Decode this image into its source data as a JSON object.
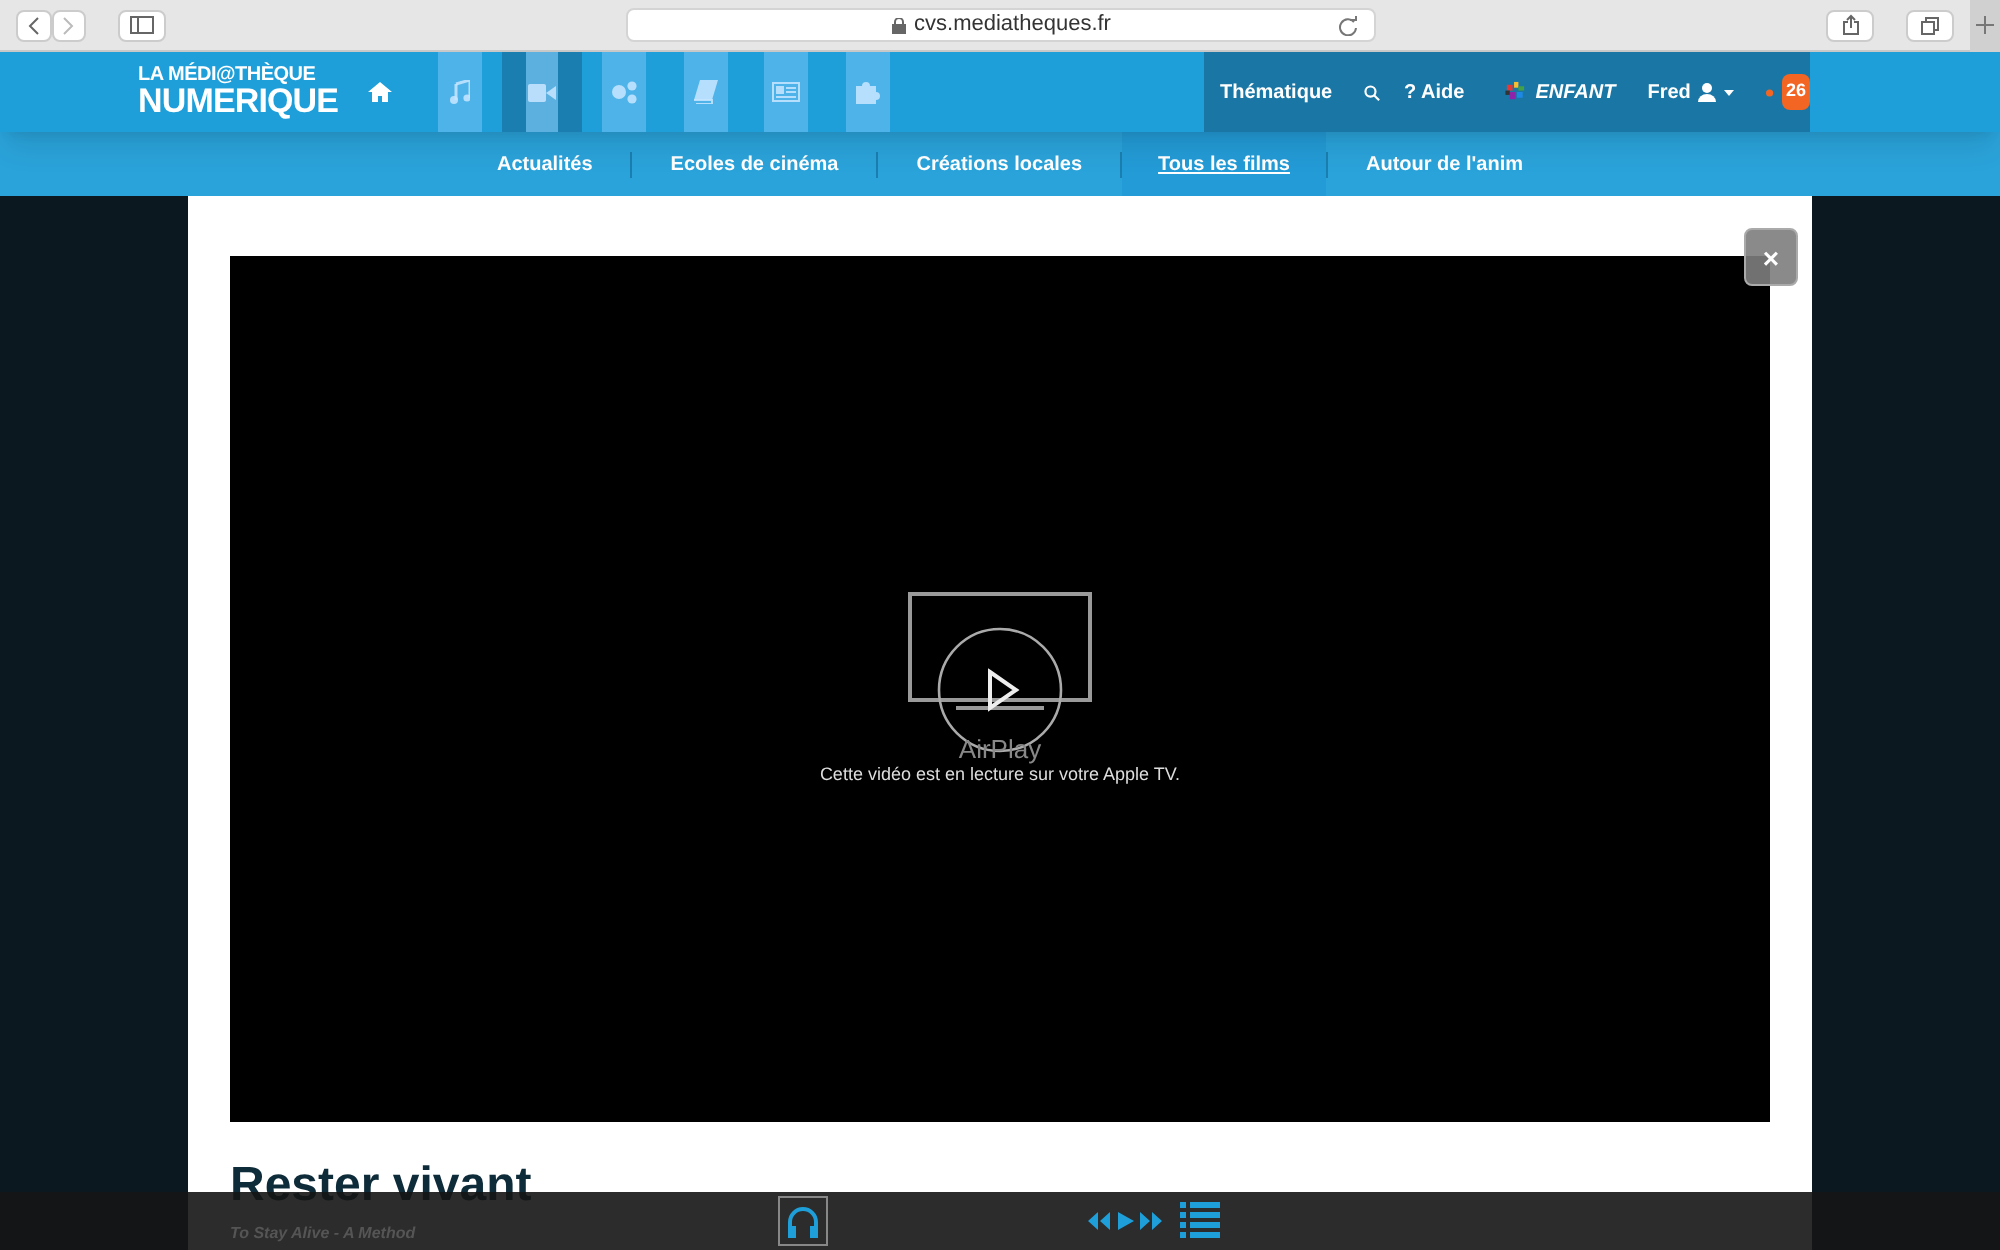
{
  "browser": {
    "url": "cvs.mediatheques.fr"
  },
  "header": {
    "logo": [
      "LA MÉDI@THÈQUE",
      "NUMERIQUE"
    ],
    "nav": [
      {
        "kind": "home",
        "selected": false
      },
      {
        "kind": "music",
        "selected": false
      },
      {
        "kind": "video",
        "selected": true
      },
      {
        "kind": "gears",
        "selected": false
      },
      {
        "kind": "book",
        "selected": false
      },
      {
        "kind": "news",
        "selected": false
      },
      {
        "kind": "puzzle",
        "selected": false
      }
    ],
    "thematique": "Thématique",
    "help": "? Aide",
    "kids": "ENFANT",
    "user": "Fred",
    "notifications": "26"
  },
  "subnav": [
    {
      "label": "Actualités",
      "selected": false
    },
    {
      "label": "Ecoles de cinéma",
      "selected": false
    },
    {
      "label": "Créations locales",
      "selected": false
    },
    {
      "label": "Tous les films",
      "selected": true
    },
    {
      "label": "Autour de l'anim",
      "selected": false
    }
  ],
  "video": {
    "airplay_label": "AirPlay",
    "message": "Cette vidéo est en lecture sur votre Apple TV."
  },
  "close": "×",
  "film": {
    "title": "Rester vivant",
    "subtitle": "To Stay Alive - A Method"
  }
}
